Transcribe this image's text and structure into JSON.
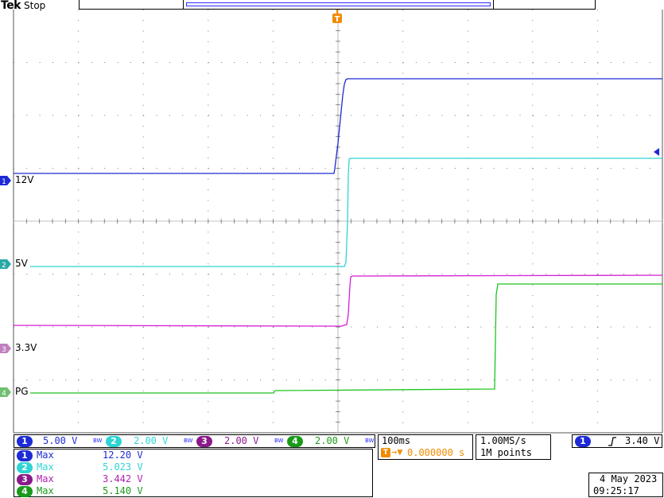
{
  "header": {
    "brand": "Tek",
    "state": "Stop"
  },
  "trigger_marker": "T",
  "channels": [
    {
      "num": "1",
      "label": "12V",
      "color": "#1d2bd6"
    },
    {
      "num": "2",
      "label": "5V",
      "color": "#2fd4d4"
    },
    {
      "num": "3",
      "label": "3.3V",
      "color": "#d41fd4"
    },
    {
      "num": "4",
      "label": "PG",
      "color": "#1fc41f"
    }
  ],
  "scales": [
    {
      "num": "1",
      "value": "5.00 V",
      "bw": "BW"
    },
    {
      "num": "2",
      "value": "2.00 V",
      "bw": "BW"
    },
    {
      "num": "3",
      "value": "2.00 V",
      "bw": "BW"
    },
    {
      "num": "4",
      "value": "2.00 V",
      "bw": "BW"
    }
  ],
  "horizontal": {
    "timebase": "100ms",
    "trigger_position": "0.000000 s",
    "sample_rate": "1.00MS/s",
    "record_length": "1M points"
  },
  "trigger": {
    "source": "1",
    "slope_icon": "rising-edge-icon",
    "level": "3.40 V"
  },
  "measurements": [
    {
      "num": "1",
      "type": "Max",
      "value": "12.20 V"
    },
    {
      "num": "2",
      "type": "Max",
      "value": "5.023 V"
    },
    {
      "num": "3",
      "type": "Max",
      "value": "3.442 V"
    },
    {
      "num": "4",
      "type": "Max",
      "value": "5.140 V"
    }
  ],
  "datetime": {
    "date": "4 May 2023",
    "time": "09:25:17"
  },
  "colors": {
    "trigger_orange": "#f08c00",
    "grid": "#666666"
  }
}
